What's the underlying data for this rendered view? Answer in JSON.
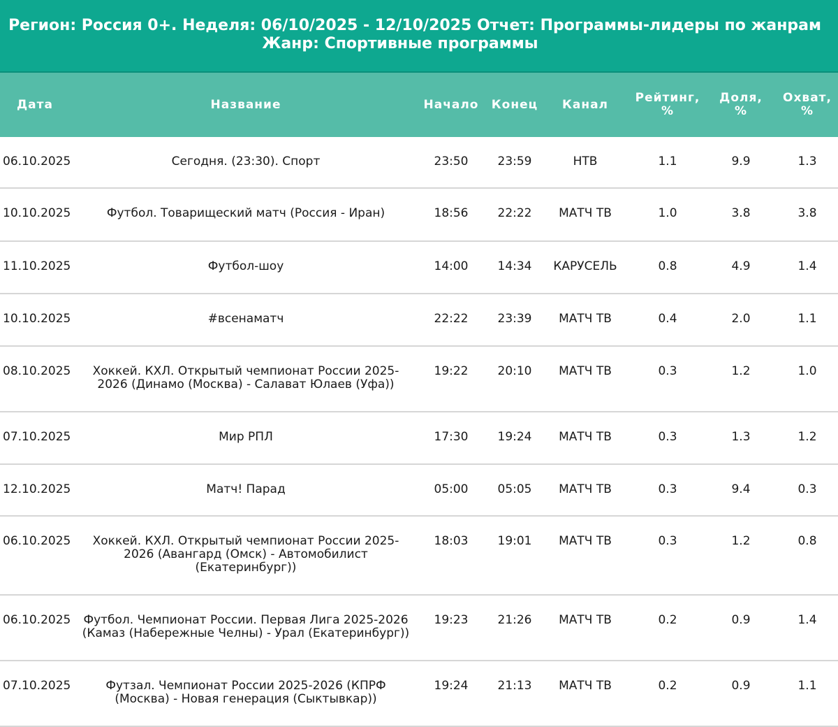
{
  "header": {
    "line1": "Регион: Россия 0+. Неделя: 06/10/2025 - 12/10/2025 Отчет: Программы-лидеры по жанрам",
    "line2": "Жанр: Спортивные программы"
  },
  "columns": {
    "date": "Дата",
    "name": "Название",
    "start": "Начало",
    "end": "Конец",
    "channel": "Канал",
    "rating": "Рейтинг,\n%",
    "share": "Доля,\n%",
    "reach": "Охват,\n%"
  },
  "rows": [
    {
      "date": "06.10.2025",
      "name": "Сегодня. (23:30). Спорт",
      "start": "23:50",
      "end": "23:59",
      "channel": "НТВ",
      "rating": "1.1",
      "share": "9.9",
      "reach": "1.3"
    },
    {
      "date": "10.10.2025",
      "name": "Футбол. Товарищеский матч (Россия - Иран)",
      "start": "18:56",
      "end": "22:22",
      "channel": "МАТЧ ТВ",
      "rating": "1.0",
      "share": "3.8",
      "reach": "3.8"
    },
    {
      "date": "11.10.2025",
      "name": "Футбол-шоу",
      "start": "14:00",
      "end": "14:34",
      "channel": "КАРУСЕЛЬ",
      "rating": "0.8",
      "share": "4.9",
      "reach": "1.4"
    },
    {
      "date": "10.10.2025",
      "name": "#всенаматч",
      "start": "22:22",
      "end": "23:39",
      "channel": "МАТЧ ТВ",
      "rating": "0.4",
      "share": "2.0",
      "reach": "1.1"
    },
    {
      "date": "08.10.2025",
      "name": "Хоккей. КХЛ. Открытый чемпионат России 2025-2026 (Динамо (Москва) - Салават Юлаев (Уфа))",
      "start": "19:22",
      "end": "20:10",
      "channel": "МАТЧ ТВ",
      "rating": "0.3",
      "share": "1.2",
      "reach": "1.0"
    },
    {
      "date": "07.10.2025",
      "name": "Мир РПЛ",
      "start": "17:30",
      "end": "19:24",
      "channel": "МАТЧ ТВ",
      "rating": "0.3",
      "share": "1.3",
      "reach": "1.2"
    },
    {
      "date": "12.10.2025",
      "name": "Матч! Парад",
      "start": "05:00",
      "end": "05:05",
      "channel": "МАТЧ ТВ",
      "rating": "0.3",
      "share": "9.4",
      "reach": "0.3"
    },
    {
      "date": "06.10.2025",
      "name": "Хоккей. КХЛ. Открытый чемпионат России 2025-2026 (Авангард (Омск) - Автомобилист (Екатеринбург))",
      "start": "18:03",
      "end": "19:01",
      "channel": "МАТЧ ТВ",
      "rating": "0.3",
      "share": "1.2",
      "reach": "0.8"
    },
    {
      "date": "06.10.2025",
      "name": "Футбол. Чемпионат России. Первая Лига 2025-2026 (Камаз (Набережные Челны) - Урал (Екатеринбург))",
      "start": "19:23",
      "end": "21:26",
      "channel": "МАТЧ ТВ",
      "rating": "0.2",
      "share": "0.9",
      "reach": "1.4"
    },
    {
      "date": "07.10.2025",
      "name": "Футзал. Чемпионат России 2025-2026 (КПРФ (Москва) - Новая генерация (Сыктывкар))",
      "start": "19:24",
      "end": "21:13",
      "channel": "МАТЧ ТВ",
      "rating": "0.2",
      "share": "0.9",
      "reach": "1.1"
    }
  ]
}
